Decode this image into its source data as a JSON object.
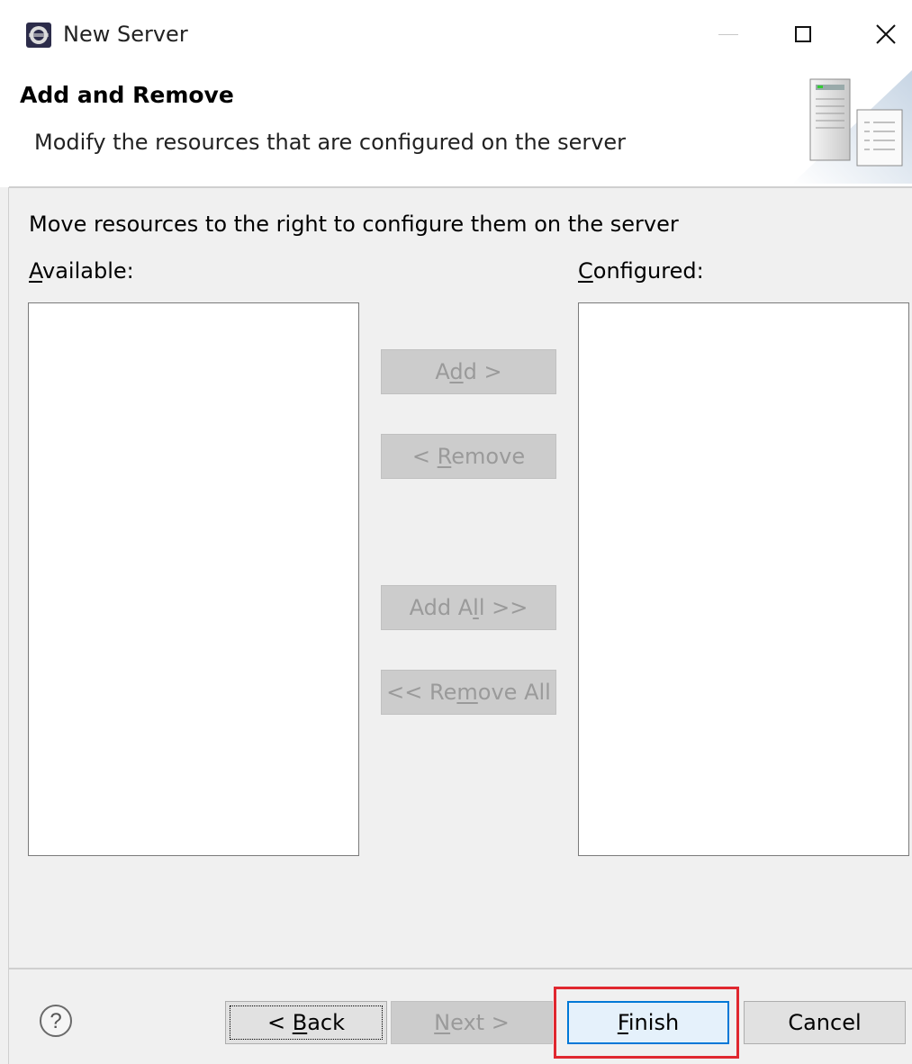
{
  "window": {
    "title": "New Server",
    "controls": [
      "minimize",
      "maximize",
      "close"
    ]
  },
  "header": {
    "title": "Add and Remove",
    "description": "Modify the resources that are configured on the server",
    "graphic_icon": "server-wizard-banner-icon"
  },
  "body": {
    "instruction": "Move resources to the right to configure them on the server",
    "available_label": "Available:",
    "configured_label": "Configured:",
    "available_items": [],
    "configured_items": []
  },
  "transfer_buttons": {
    "add": "Add >",
    "remove": "< Remove",
    "add_all": "Add All >>",
    "remove_all": "<< Remove All"
  },
  "footer": {
    "help_icon": "question-mark-icon",
    "back": "< Back",
    "next": "Next >",
    "finish": "Finish",
    "cancel": "Cancel"
  },
  "colors": {
    "highlight": "#e0272f",
    "focus_accent": "#0078d7",
    "disabled_text": "#9a9a9a"
  }
}
